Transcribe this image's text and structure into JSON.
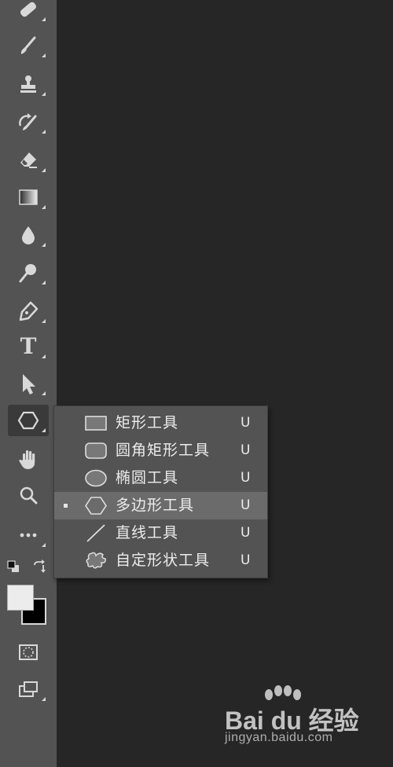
{
  "toolbar": {
    "tools": [
      {
        "name": "healing-brush",
        "icon": "bandage-icon"
      },
      {
        "name": "brush",
        "icon": "brush-icon"
      },
      {
        "name": "clone-stamp",
        "icon": "stamp-icon"
      },
      {
        "name": "history-brush",
        "icon": "history-brush-icon"
      },
      {
        "name": "eraser",
        "icon": "eraser-icon"
      },
      {
        "name": "gradient",
        "icon": "gradient-icon"
      },
      {
        "name": "blur",
        "icon": "drop-icon"
      },
      {
        "name": "dodge",
        "icon": "dodge-icon"
      },
      {
        "name": "pen",
        "icon": "pen-icon"
      },
      {
        "name": "type",
        "icon": "type-icon",
        "label": "T"
      },
      {
        "name": "path-selection",
        "icon": "arrow-icon"
      },
      {
        "name": "shape",
        "icon": "polygon-icon",
        "active": true
      },
      {
        "name": "hand",
        "icon": "hand-icon"
      },
      {
        "name": "zoom",
        "icon": "magnifier-icon"
      },
      {
        "name": "more",
        "icon": "ellipsis-icon"
      }
    ],
    "colors": {
      "foreground": "#ececec",
      "background": "#000000"
    },
    "extra": [
      "quick-mask-icon",
      "screen-mode-icon",
      "swap-colors-icon",
      "default-colors-icon"
    ]
  },
  "flyout": {
    "items": [
      {
        "label": "矩形工具",
        "key": "U",
        "icon": "rectangle-icon",
        "selected": false
      },
      {
        "label": "圆角矩形工具",
        "key": "U",
        "icon": "rounded-rectangle-icon",
        "selected": false
      },
      {
        "label": "椭圆工具",
        "key": "U",
        "icon": "ellipse-icon",
        "selected": false
      },
      {
        "label": "多边形工具",
        "key": "U",
        "icon": "polygon-icon",
        "selected": true
      },
      {
        "label": "直线工具",
        "key": "U",
        "icon": "line-icon",
        "selected": false
      },
      {
        "label": "自定形状工具",
        "key": "U",
        "icon": "custom-shape-icon",
        "selected": false
      }
    ]
  },
  "watermark": {
    "brand": "Bai du 经验",
    "url": "jingyan.baidu.com"
  },
  "theme": {
    "panel": "#535353",
    "canvas": "#262626",
    "selected": "#6b6b6b",
    "icon": "#d8d8d8"
  }
}
